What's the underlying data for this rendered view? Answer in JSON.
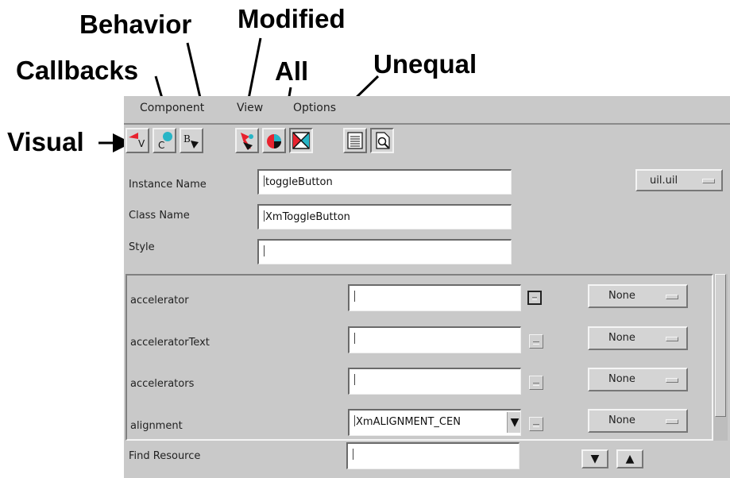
{
  "callouts": {
    "behavior": "Behavior",
    "modified": "Modified",
    "callbacks": "Callbacks",
    "all": "All",
    "unequal": "Unequal",
    "visual": "Visual"
  },
  "menu": {
    "component": "Component",
    "view": "View",
    "options": "Options"
  },
  "toolbar": {
    "visual_glyph": "V",
    "callbacks_glyph": "C",
    "behavior_glyph": "B"
  },
  "fields": {
    "instance_label": "Instance Name",
    "instance_value": "toggleButton",
    "class_label": "Class Name",
    "class_value": "XmToggleButton",
    "style_label": "Style",
    "style_value": "",
    "file_option": "uil.uil"
  },
  "resources": [
    {
      "name": "accelerator",
      "value": "",
      "mode": "None"
    },
    {
      "name": "acceleratorText",
      "value": "",
      "mode": "None"
    },
    {
      "name": "accelerators",
      "value": "",
      "mode": "None"
    },
    {
      "name": "alignment",
      "value": "XmALIGNMENT_CEN",
      "mode": "None"
    }
  ],
  "find": {
    "label": "Find Resource",
    "value": ""
  },
  "colors": {
    "window_bg": "#c9c9c9",
    "field_bg": "#ffffff",
    "accent_red": "#e8222e",
    "accent_cyan": "#27b5c6"
  }
}
